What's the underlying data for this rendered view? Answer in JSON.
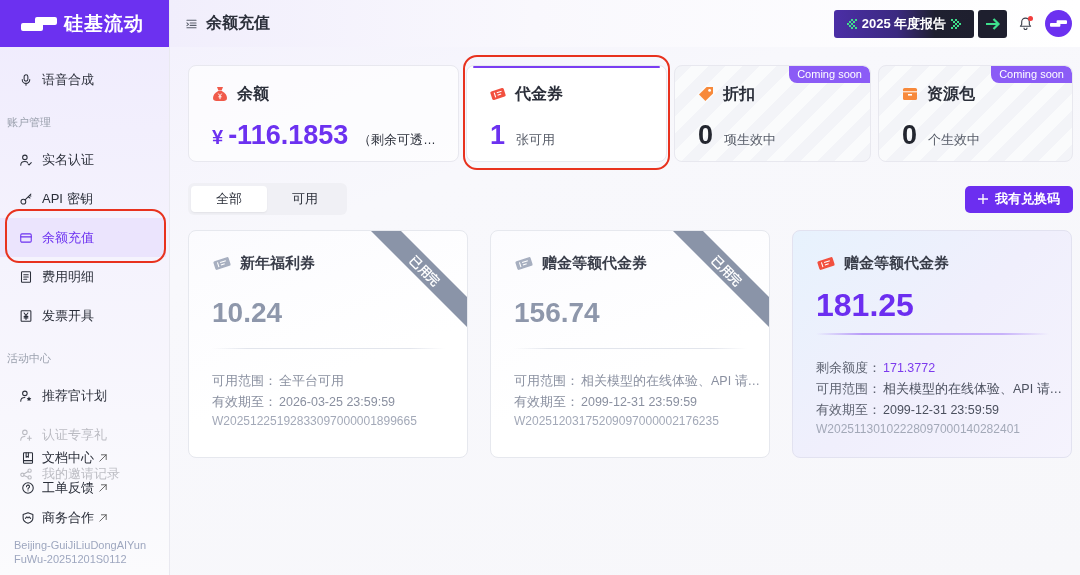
{
  "sidebar": {
    "logo": "硅基流动",
    "items": [
      {
        "kind": "item",
        "label": "语音合成",
        "selected": false,
        "faded": false,
        "circled": false
      },
      {
        "kind": "section",
        "label": "账户管理"
      },
      {
        "kind": "item",
        "label": "实名认证",
        "selected": false,
        "faded": false,
        "circled": false
      },
      {
        "kind": "item",
        "label": "API 密钥",
        "selected": false,
        "faded": false,
        "circled": false
      },
      {
        "kind": "item",
        "label": "余额充值",
        "selected": true,
        "faded": false,
        "circled": true
      },
      {
        "kind": "item",
        "label": "费用明细",
        "selected": false,
        "faded": false,
        "circled": false
      },
      {
        "kind": "item",
        "label": "发票开具",
        "selected": false,
        "faded": false,
        "circled": false
      },
      {
        "kind": "section",
        "label": "活动中心"
      },
      {
        "kind": "item",
        "label": "推荐官计划",
        "selected": false,
        "faded": false,
        "circled": false
      },
      {
        "kind": "item",
        "label": "认证专享礼",
        "selected": false,
        "faded": true,
        "circled": false
      },
      {
        "kind": "item",
        "label": "我的邀请记录",
        "selected": false,
        "faded": true,
        "circled": false
      }
    ],
    "links": [
      {
        "label": "文档中心",
        "external": true
      },
      {
        "label": "工单反馈",
        "external": true
      },
      {
        "label": "商务合作",
        "external": true
      }
    ],
    "build": "Beijing-GuiJiLiuDongAIYunFuWu-20251201S0112"
  },
  "topbar": {
    "title": "余额充值",
    "report_banner": "2025 年度报告",
    "notifications_unread": true
  },
  "summary_cards": [
    {
      "kind": "balance",
      "title": "余额",
      "currency": "¥",
      "value": "-116.1853",
      "note": "（剩余可透…",
      "selected": false,
      "circled": false
    },
    {
      "kind": "voucher",
      "title": "代金券",
      "value": "1",
      "unit": "张可用",
      "selected": true,
      "circled": true
    },
    {
      "kind": "discount",
      "title": "折扣",
      "value": "0",
      "unit": "项生效中",
      "badge": "Coming soon",
      "selected": false,
      "circled": false
    },
    {
      "kind": "package",
      "title": "资源包",
      "value": "0",
      "unit": "个生效中",
      "badge": "Coming soon",
      "selected": false,
      "circled": false
    }
  ],
  "filter_tabs": [
    {
      "label": "全部",
      "selected": true
    },
    {
      "label": "可用",
      "selected": false
    }
  ],
  "redeem_button": "我有兑换码",
  "vouchers": [
    {
      "used": true,
      "title": "新年福利券",
      "amount": "10.24",
      "ribbon": "已用完",
      "details": [
        {
          "label": "可用范围：",
          "value": "全平台可用",
          "highlight": false
        },
        {
          "label": "有效期至：",
          "value": "2026-03-25 23:59:59",
          "highlight": false
        }
      ],
      "code": "W20251225192833097000001899665"
    },
    {
      "used": true,
      "title": "赠金等额代金券",
      "amount": "156.74",
      "ribbon": "已用完",
      "details": [
        {
          "label": "可用范围：",
          "value": "相关模型的在线体验、API 请…",
          "highlight": false
        },
        {
          "label": "有效期至：",
          "value": "2099-12-31 23:59:59",
          "highlight": false
        }
      ],
      "code": "W20251203175209097000002176235"
    },
    {
      "used": false,
      "title": "赠金等额代金券",
      "amount": "181.25",
      "details": [
        {
          "label": "剩余额度：",
          "value": "171.3772",
          "highlight": true
        },
        {
          "label": "可用范围：",
          "value": "相关模型的在线体验、API 请…",
          "highlight": false
        },
        {
          "label": "有效期至：",
          "value": "2099-12-31 23:59:59",
          "highlight": false
        }
      ],
      "code": "W20251130102228097000140282401"
    }
  ]
}
